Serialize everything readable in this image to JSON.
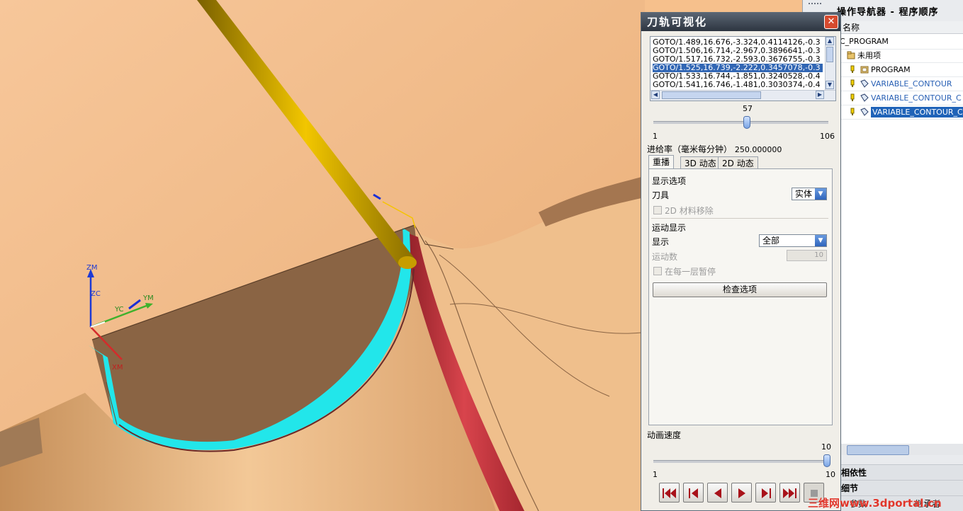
{
  "viewport": {
    "axes": {
      "zm": "ZM",
      "zc": "ZC",
      "yc": "YC",
      "ym": "YM",
      "xm": "XM"
    }
  },
  "dialog": {
    "title": "刀轨可视化",
    "close_icon": "close-icon",
    "goto_lines": [
      "GOTO/1.489,16.676,-3.324,0.4114126,-0.3",
      "GOTO/1.506,16.714,-2.967,0.3896641,-0.3",
      "GOTO/1.517,16.732,-2.593,0.3676755,-0.3",
      "GOTO/1.525,16.739,-2.222,0.3457078,-0.3",
      "GOTO/1.533,16.744,-1.851,0.3240528,-0.4",
      "GOTO/1.541,16.746,-1.481,0.3030374,-0.4"
    ],
    "selected_line_index": 3,
    "motion_slider": {
      "value": "57",
      "min": "1",
      "max": "106",
      "fraction": 0.533
    },
    "feed_rate_label": "进给率（毫米每分钟）",
    "feed_rate_value": "250.000000",
    "tabs": [
      "重播",
      "3D 动态",
      "2D 动态"
    ],
    "active_tab": 0,
    "display_options_label": "显示选项",
    "tool_label": "刀具",
    "tool_value": "实体",
    "material_removal_label": "2D 材料移除",
    "motion_display_label": "运动显示",
    "display_label": "显示",
    "display_value": "全部",
    "motion_count_label": "运动数",
    "motion_count_value": "10",
    "pause_label": "在每一层暂停",
    "check_options_label": "检查选项",
    "anim_speed_label": "动画速度",
    "speed_slider": {
      "value": "10",
      "min": "1",
      "max": "10",
      "fraction": 1.0
    },
    "playback_icons": [
      "rewind-to-start-icon",
      "step-back-icon",
      "play-reverse-icon",
      "play-forward-icon",
      "step-forward-icon",
      "fast-forward-to-end-icon",
      "stop-icon"
    ]
  },
  "navigator": {
    "title": "操作导航器 - 程序顺序",
    "column_header": "名称",
    "rows": [
      {
        "label": "C_PROGRAM",
        "style": "plain",
        "icon": ""
      },
      {
        "label": "未用项",
        "style": "plain",
        "icon": "folder-icon"
      },
      {
        "label": "PROGRAM",
        "style": "plain",
        "icon": "program-folder-icon"
      },
      {
        "label": "VARIABLE_CONTOUR",
        "style": "link",
        "icon": "operation-icon"
      },
      {
        "label": "VARIABLE_CONTOUR_C",
        "style": "link",
        "icon": "operation-icon"
      },
      {
        "label": "VARIABLE_CONTOUR_C",
        "style": "selected",
        "icon": "operation-icon"
      }
    ],
    "section_dependencies": "相依性",
    "section_details": "细节",
    "bottom_left": "参数",
    "bottom_right": "继承者"
  },
  "watermark": "三维网www.3dportal.cn"
}
